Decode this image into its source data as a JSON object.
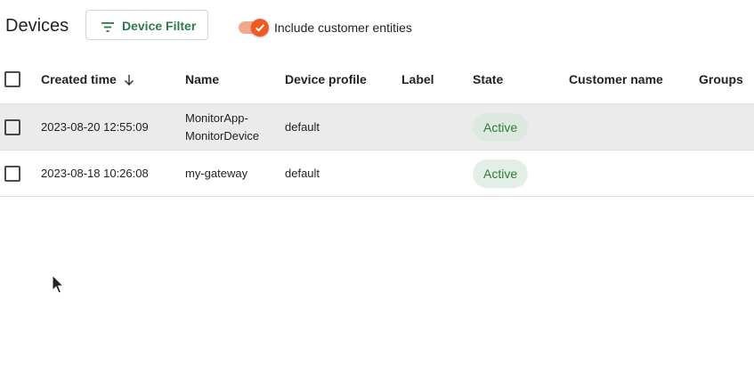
{
  "header": {
    "title": "Devices",
    "filter_button_label": "Device Filter",
    "toggle_label": "Include customer entities",
    "toggle_on": true
  },
  "table": {
    "columns": [
      "Created time",
      "Name",
      "Device profile",
      "Label",
      "State",
      "Customer name",
      "Groups"
    ],
    "sort_column": "Created time",
    "sort_direction": "descending",
    "rows": [
      {
        "created_time": "2023-08-20 12:55:09",
        "name": "MonitorApp-MonitorDevice",
        "device_profile": "default",
        "label": "",
        "state": "Active",
        "customer_name": "",
        "groups": ""
      },
      {
        "created_time": "2023-08-18 10:26:08",
        "name": "my-gateway",
        "device_profile": "default",
        "label": "",
        "state": "Active",
        "customer_name": "",
        "groups": ""
      }
    ]
  },
  "colors": {
    "accent": "#2b7a4b",
    "toggle_thumb": "#f05a22",
    "toggle_track": "#f2a88c",
    "active_badge_bg": "#e3efe6",
    "active_badge_text": "#2e7d32",
    "selected_row_bg": "#ebebeb"
  },
  "icons": {
    "filter": "filter-list-icon",
    "sort": "arrow-downward-icon",
    "toggle_check": "check-icon",
    "cursor": "mouse-pointer-icon"
  }
}
